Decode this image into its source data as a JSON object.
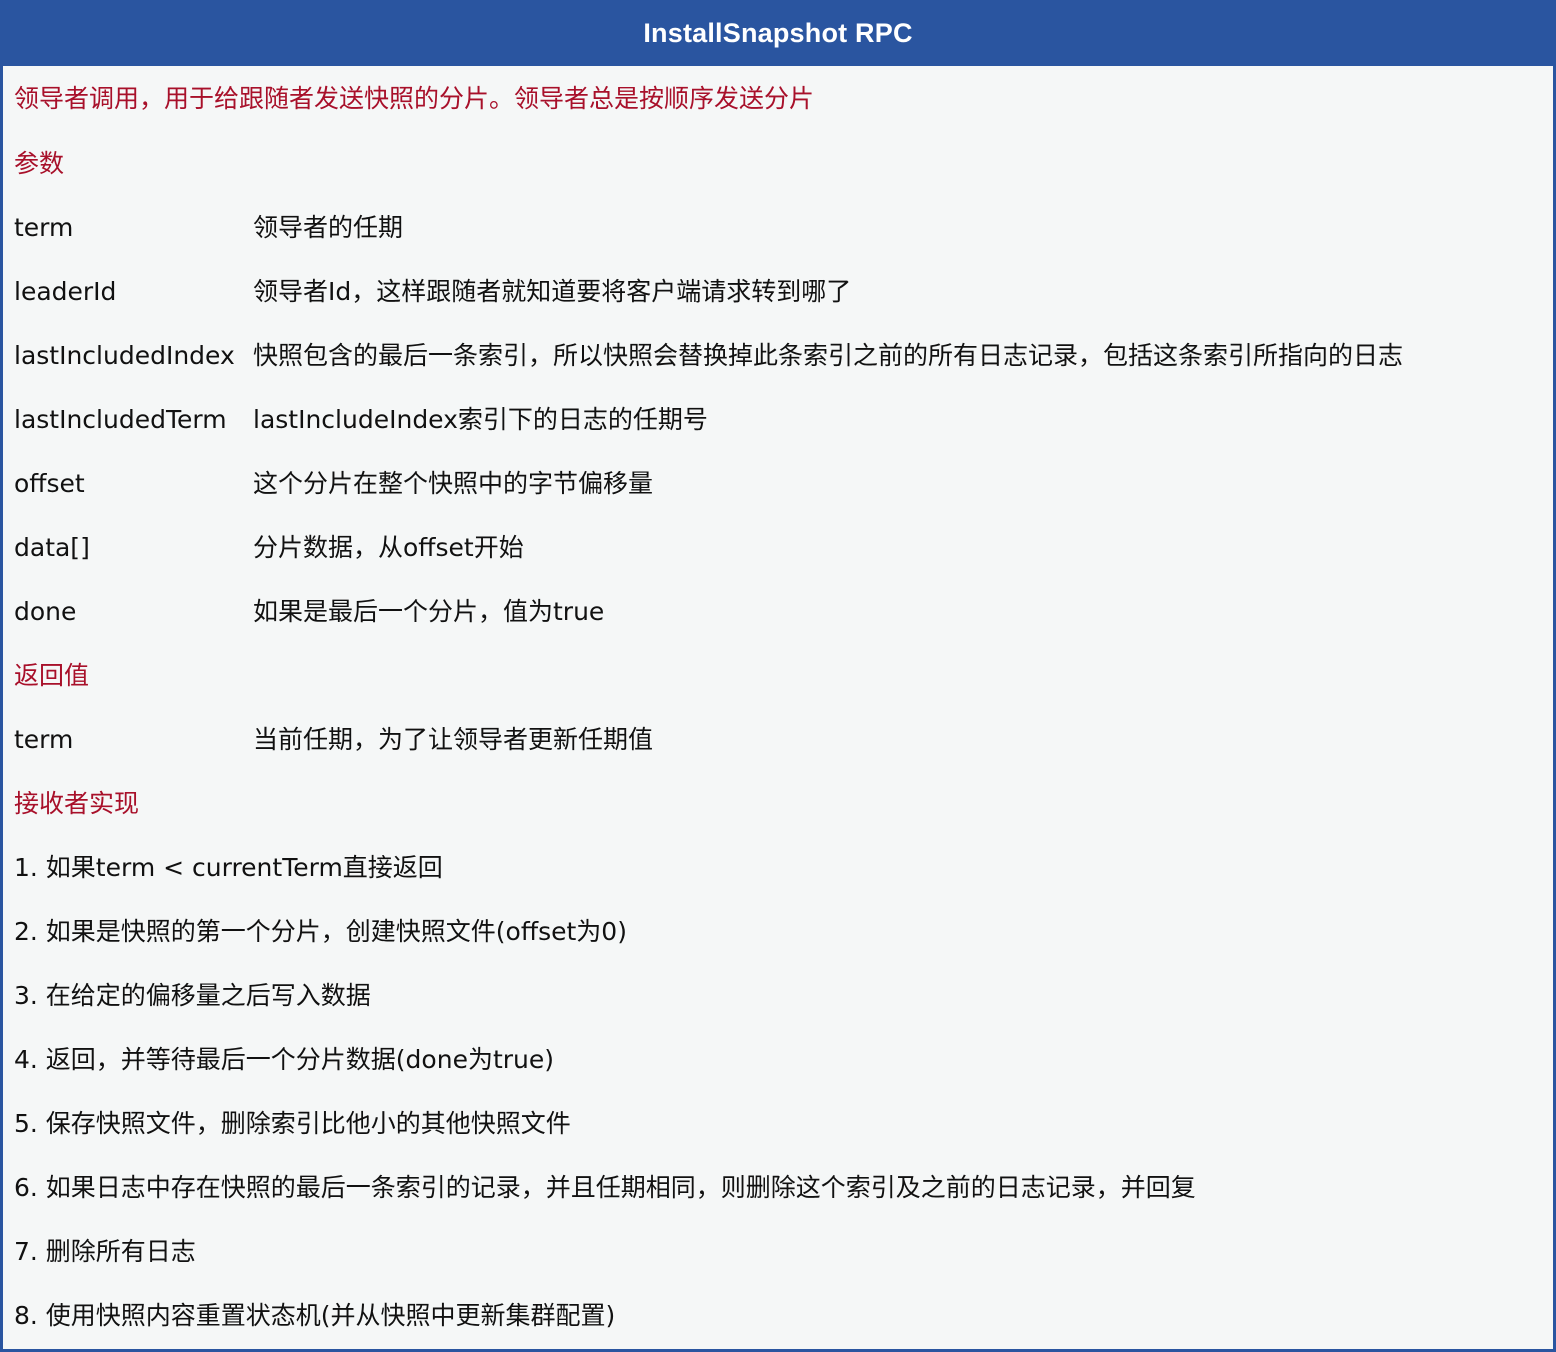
{
  "title": "InstallSnapshot RPC",
  "intro": "领导者调用，用于给跟随者发送快照的分片。领导者总是按顺序发送分片",
  "params_heading": "参数",
  "params": [
    {
      "name": "term",
      "desc": "领导者的任期"
    },
    {
      "name": "leaderId",
      "desc": "领导者Id，这样跟随者就知道要将客户端请求转到哪了"
    },
    {
      "name": "lastIncludedIndex",
      "desc": "快照包含的最后一条索引，所以快照会替换掉此条索引之前的所有日志记录，包括这条索引所指向的日志"
    },
    {
      "name": "lastIncludedTerm",
      "desc": "lastIncludeIndex索引下的日志的任期号"
    },
    {
      "name": "offset",
      "desc": "这个分片在整个快照中的字节偏移量"
    },
    {
      "name": "data[]",
      "desc": "分片数据，从offset开始"
    },
    {
      "name": "done",
      "desc": "如果是最后一个分片，值为true"
    }
  ],
  "returns_heading": "返回值",
  "returns": [
    {
      "name": "term",
      "desc": "当前任期，为了让领导者更新任期值"
    }
  ],
  "impl_heading": "接收者实现",
  "steps": [
    "1. 如果term < currentTerm直接返回",
    "2. 如果是快照的第一个分片，创建快照文件(offset为0)",
    "3. 在给定的偏移量之后写入数据",
    "4. 返回，并等待最后一个分片数据(done为true)",
    "5. 保存快照文件，删除索引比他小的其他快照文件",
    "6. 如果日志中存在快照的最后一条索引的记录，并且任期相同，则删除这个索引及之前的日志记录，并回复",
    "7. 删除所有日志",
    "8. 使用快照内容重置状态机(并从快照中更新集群配置)"
  ]
}
